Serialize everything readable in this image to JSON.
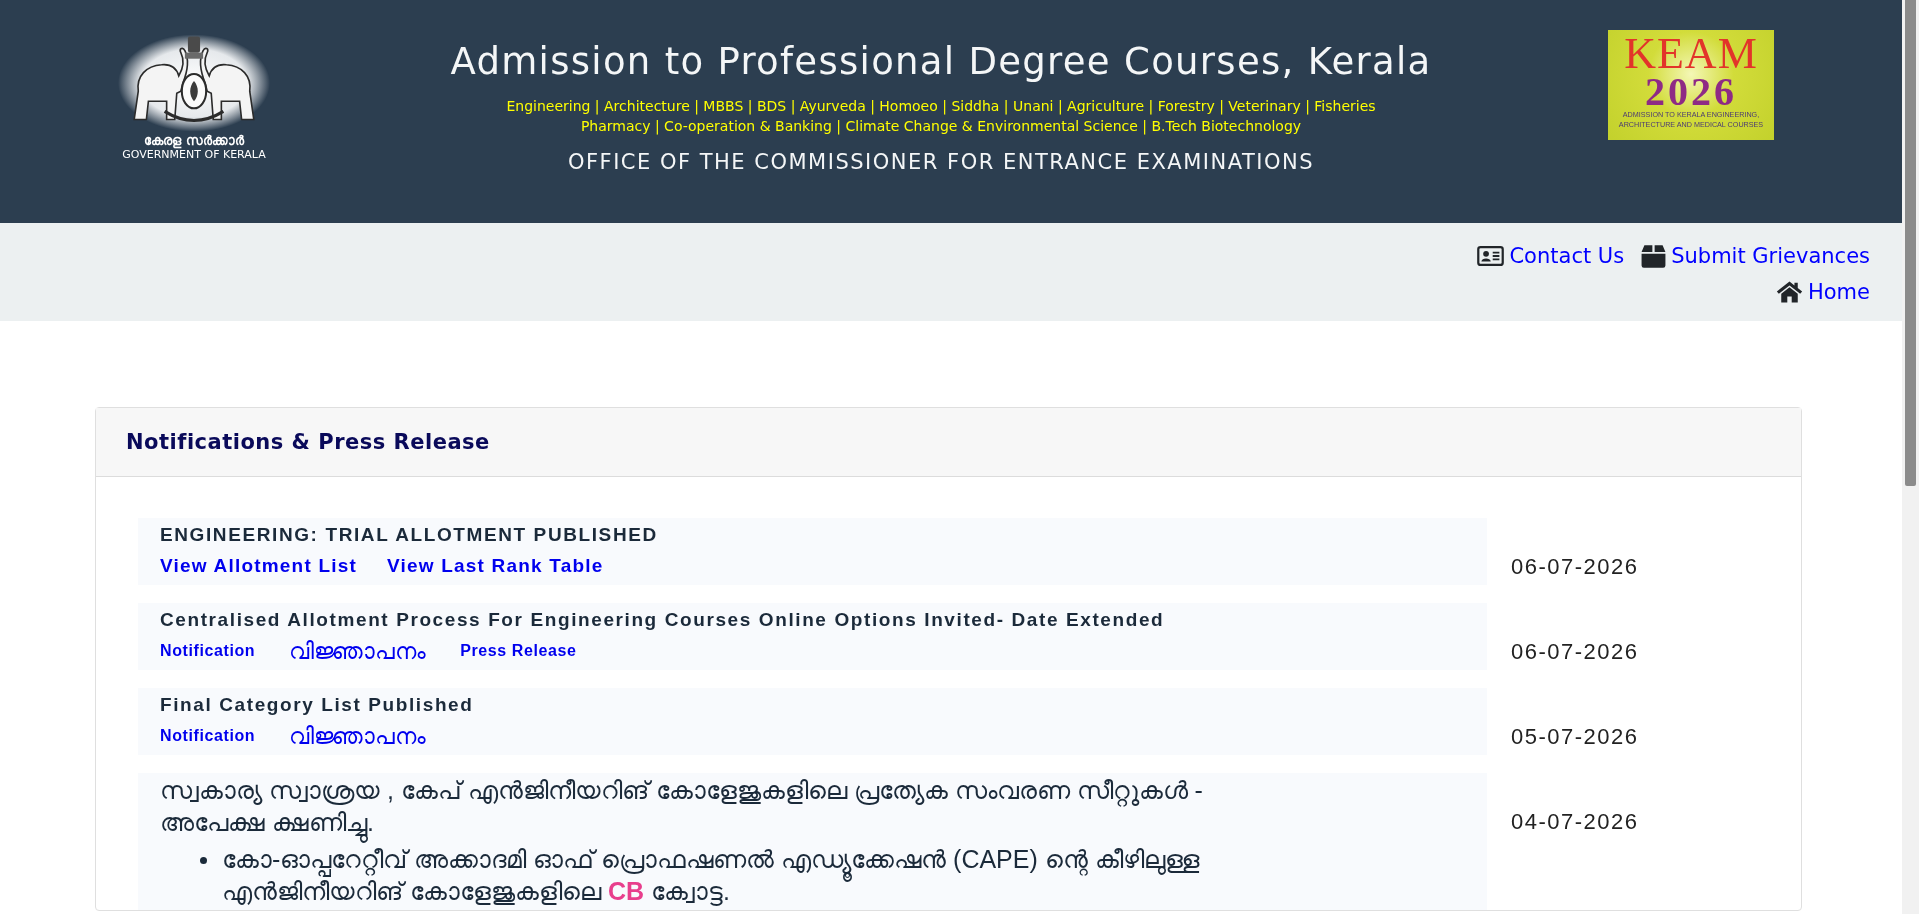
{
  "header": {
    "emblem_caption": [
      "കേരള സർക്കാർ",
      "GOVERNMENT OF KERALA"
    ],
    "title": "Admission to Professional Degree Courses, Kerala",
    "courses": [
      "Engineering | Architecture | MBBS | BDS | Ayurveda | Homoeo | Siddha | Unani | Agriculture | Forestry | Veterinary | Fisheries",
      "Pharmacy | Co-operation & Banking | Climate Change & Environmental Science | B.Tech Biotechnology"
    ],
    "office": "OFFICE OF THE COMMISSIONER FOR ENTRANCE EXAMINATIONS",
    "badge": {
      "name": "KEAM",
      "year": "2026",
      "caption": [
        "ADMISSION TO KERALA ENGINEERING,",
        "ARCHITECTURE AND MEDICAL COURSES"
      ]
    }
  },
  "top_links": [
    [
      {
        "label": "Contact Us",
        "kind": "contact"
      },
      {
        "label": "Submit Grievances",
        "kind": "grievance"
      }
    ],
    [
      {
        "label": "Home",
        "kind": "home"
      }
    ]
  ],
  "notifications": {
    "title": "Notifications & Press Release",
    "items": [
      {
        "kind": "major",
        "title": "ENGINEERING: TRIAL ALLOTMENT PUBLISHED",
        "links": [
          {
            "text": "View Allotment List",
            "kind": "latin"
          },
          {
            "text": "View Last Rank Table",
            "kind": "latin"
          }
        ],
        "date": "06-07-2026"
      },
      {
        "kind": "standard",
        "title": "Centralised Allotment Process For Engineering Courses Online Options Invited- Date Extended",
        "links": [
          {
            "text": "Notification",
            "kind": "latin"
          },
          {
            "text": "വിജ്ഞാപനം",
            "kind": "malayalam"
          },
          {
            "text": "Press Release",
            "kind": "latin"
          }
        ],
        "date": "06-07-2026"
      },
      {
        "kind": "standard",
        "title": "Final Category List Published",
        "links": [
          {
            "text": "Notification",
            "kind": "latin"
          },
          {
            "text": "വിജ്ഞാപനം",
            "kind": "malayalam"
          }
        ],
        "date": "05-07-2026"
      },
      {
        "kind": "detail",
        "title": "സ്വകാര്യ സ്വാശ്രയ , കേപ് എൻജിനീയറിങ് കോളേജുകളിലെ പ്രത്യേക സംവരണ സീറ്റുകൾ - അപേക്ഷ ക്ഷണിച്ചു.",
        "bullets": [
          "കോ-ഓപ്പറേറ്റീവ് അക്കാദമി ഓഫ് പ്രൊഫഷണൽ എഡ്യൂക്കേഷൻ (CAPE) ന്റെ കീഴിലുള്ള എൻജിനീയറിങ് കോളേജുകളിലെ **CB** ക്വോട്ട."
        ],
        "date": "04-07-2026"
      }
    ]
  }
}
